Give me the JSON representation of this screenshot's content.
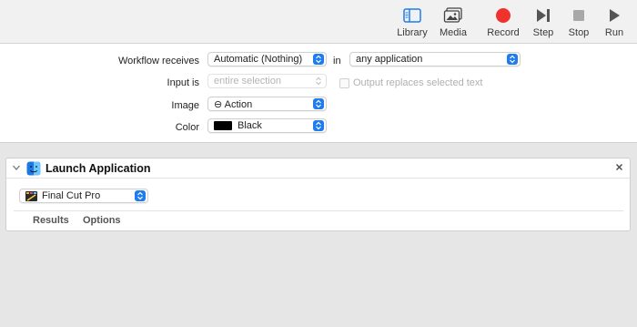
{
  "toolbar": {
    "items": [
      {
        "label": "Library",
        "icon": "sidebar-icon"
      },
      {
        "label": "Media",
        "icon": "photos-icon"
      },
      {
        "label": "Record",
        "icon": "record-icon"
      },
      {
        "label": "Step",
        "icon": "step-icon"
      },
      {
        "label": "Stop",
        "icon": "stop-icon"
      },
      {
        "label": "Run",
        "icon": "play-icon"
      }
    ]
  },
  "workflow": {
    "receives_label": "Workflow receives",
    "receives_value": "Automatic (Nothing)",
    "in_label": "in",
    "in_value": "any application",
    "input_is_label": "Input is",
    "input_is_value": "entire selection",
    "output_replaces_label": "Output replaces selected text",
    "image_label": "Image",
    "image_value": "⊖ Action",
    "color_label": "Color",
    "color_value": "Black"
  },
  "action": {
    "title": "Launch Application",
    "app_value": "Final Cut Pro",
    "tabs": [
      "Results",
      "Options"
    ]
  },
  "colors": {
    "accent": "#1e7cf0",
    "record": "#f0322d",
    "color_swatch": "#000000"
  }
}
